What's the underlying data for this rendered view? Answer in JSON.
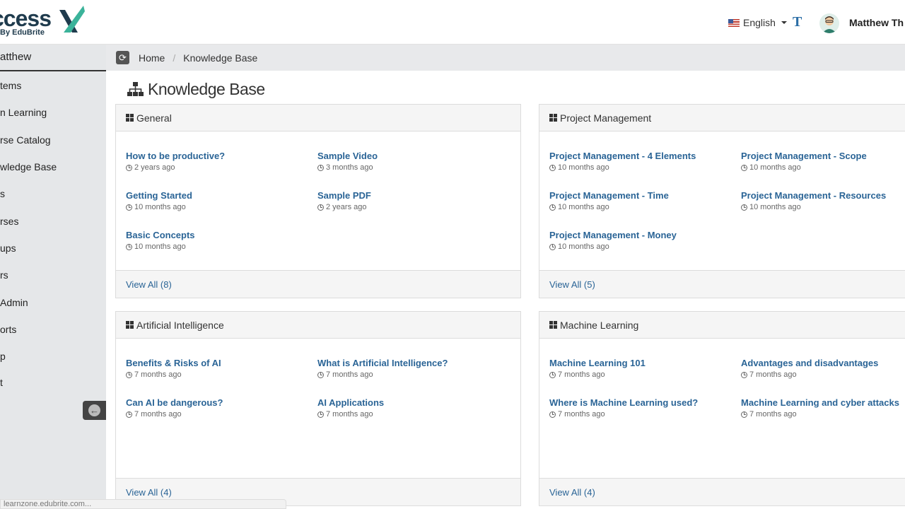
{
  "header": {
    "brand": "ccess",
    "brand_sub": "By EduBrite",
    "language": "English",
    "font_icon": "T",
    "user_name": "Matthew Th"
  },
  "sidebar": {
    "user": "atthew",
    "items": [
      {
        "label": "tems"
      },
      {
        "label": "n Learning"
      },
      {
        "label": "rse Catalog"
      },
      {
        "label": "wledge Base"
      },
      {
        "label": "s"
      },
      {
        "label": "rses"
      },
      {
        "label": "ups"
      },
      {
        "label": "rs"
      },
      {
        "label": "Admin"
      },
      {
        "label": "orts"
      },
      {
        "label": "p"
      },
      {
        "label": "t"
      }
    ]
  },
  "breadcrumb": {
    "home": "Home",
    "current": "Knowledge Base"
  },
  "page": {
    "title": "Knowledge Base"
  },
  "panels": [
    {
      "title": "General",
      "articles": [
        {
          "title": "How to be productive?",
          "age": "2 years ago"
        },
        {
          "title": "Sample Video",
          "age": "3 months ago"
        },
        {
          "title": "Getting Started",
          "age": "10 months ago"
        },
        {
          "title": "Sample PDF",
          "age": "2 years ago"
        },
        {
          "title": "Basic Concepts",
          "age": "10 months ago"
        }
      ],
      "view_all": "View All (8)"
    },
    {
      "title": "Project Management",
      "articles": [
        {
          "title": "Project Management - 4 Elements",
          "age": "10 months ago"
        },
        {
          "title": "Project Management - Scope",
          "age": "10 months ago"
        },
        {
          "title": "Project Management - Time",
          "age": "10 months ago"
        },
        {
          "title": "Project Management - Resources",
          "age": "10 months ago"
        },
        {
          "title": "Project Management - Money",
          "age": "10 months ago"
        }
      ],
      "view_all": "View All (5)"
    },
    {
      "title": "Artificial Intelligence",
      "articles": [
        {
          "title": "Benefits & Risks of AI",
          "age": "7 months ago"
        },
        {
          "title": "What is Artificial Intelligence?",
          "age": "7 months ago"
        },
        {
          "title": "Can AI be dangerous?",
          "age": "7 months ago"
        },
        {
          "title": "AI Applications",
          "age": "7 months ago"
        }
      ],
      "view_all": "View All (4)"
    },
    {
      "title": "Machine Learning",
      "articles": [
        {
          "title": "Machine Learning 101",
          "age": "7 months ago"
        },
        {
          "title": "Advantages and disadvantages",
          "age": "7 months ago"
        },
        {
          "title": "Where is Machine Learning used?",
          "age": "7 months ago"
        },
        {
          "title": "Machine Learning and cyber attacks",
          "age": "7 months ago"
        }
      ],
      "view_all": "View All (4)"
    }
  ],
  "status_bar": {
    "url": "learnzone.edubrite.com..."
  },
  "colors": {
    "link": "#2a6496",
    "sidebar_bg": "#e5e7e9",
    "brand_green": "#3bb39a"
  }
}
